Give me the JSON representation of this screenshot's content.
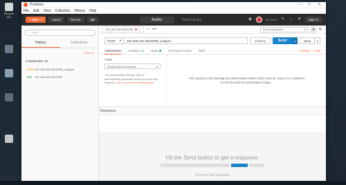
{
  "desktop": {
    "icons": [
      {
        "label": "Recycle Bin"
      },
      {
        "label": ""
      },
      {
        "label": ""
      },
      {
        "label": ""
      },
      {
        "label": ""
      }
    ]
  },
  "window": {
    "title": "Postman",
    "menu": [
      "File",
      "Edit",
      "View",
      "Collection",
      "History",
      "Help"
    ]
  },
  "header": {
    "new_label": "New",
    "import_label": "Import",
    "runner_label": "Runner",
    "tabs": [
      {
        "label": "Builder",
        "active": true
      },
      {
        "label": "Team Library",
        "active": false
      }
    ],
    "sync_label": "IN SYNC",
    "signin_label": "Sign In"
  },
  "sidebar": {
    "filter_placeholder": "Filter",
    "tabs": [
      {
        "label": "History",
        "active": true
      },
      {
        "label": "Collections",
        "active": false
      }
    ],
    "clear_all": "Clear all",
    "day": "September 18",
    "items": [
      {
        "method": "POST",
        "url": "192.168.100.206:9200/_analyze"
      },
      {
        "method": "GET",
        "url": "192.168.100.206:9200"
      }
    ]
  },
  "main": {
    "open_tab": "192.168.100.206:9200",
    "environment": "No Environment",
    "method": "POST",
    "url": "192.168.100.206:9200/_analyze",
    "params_label": "Params",
    "send_label": "Send",
    "save_label": "Save",
    "sub_tabs": [
      {
        "label": "Authorization",
        "count": ""
      },
      {
        "label": "Headers",
        "count": "(1)"
      },
      {
        "label": "Body",
        "count": ""
      },
      {
        "label": "Pre-request Script",
        "count": ""
      },
      {
        "label": "Tests",
        "count": ""
      }
    ],
    "cookies_label": "Cookies",
    "code_label": "Code",
    "auth": {
      "type_label": "TYPE",
      "type_value": "Inherit auth from parent",
      "help_text": "The authorization header will be automatically generated when you send the request.",
      "learn_more": "Learn more about authorization",
      "message": "This request is not inheriting any authorization helper at the moment. Save it in a collection to use the parent's authorization helper."
    },
    "response_label": "Response",
    "hit_send": "Hit the Send button to get a response.",
    "do_more": "Do more with requests"
  }
}
